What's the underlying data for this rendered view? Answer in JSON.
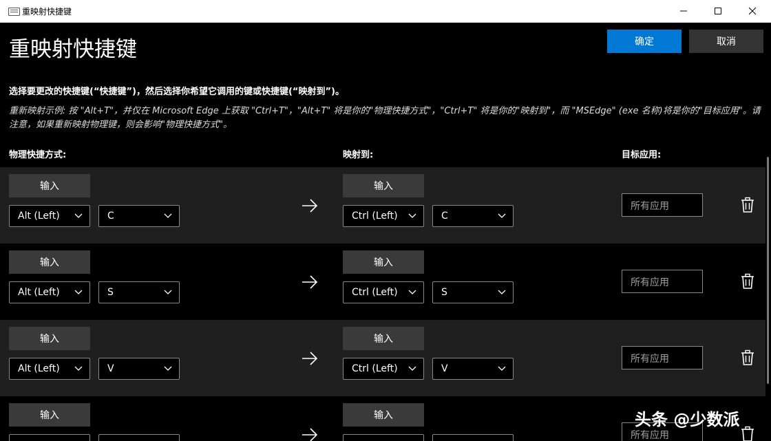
{
  "window": {
    "title": "重映射快捷键"
  },
  "header": {
    "title": "重映射快捷键",
    "ok_label": "确定",
    "cancel_label": "取消"
  },
  "instructions": "选择要更改的快捷键(“快捷键”)，然后选择你希望它调用的键或快捷键(“映射到”)。",
  "example": "重新映射示例: 按 \"Alt+T\"，并仅在 Microsoft Edge 上获取 \"Ctrl+T\"，\"Alt+T\" 将是你的\"物理快捷方式\"，\"Ctrl+T\" 将是你的\"映射到\"，而 \"MSEdge\" (exe 名称)将是你的\"目标应用\"。请注意，如果重新映射物理键，则会影响\"物理快捷方式\"。",
  "columns": {
    "physical": "物理快捷方式:",
    "mapped": "映射到:",
    "target": "目标应用:"
  },
  "rows": [
    {
      "input_label": "输入",
      "phys_mod": "Alt (Left)",
      "phys_key": "C",
      "map_input_label": "输入",
      "map_mod": "Ctrl (Left)",
      "map_key": "C",
      "target_placeholder": "所有应用"
    },
    {
      "input_label": "输入",
      "phys_mod": "Alt (Left)",
      "phys_key": "S",
      "map_input_label": "输入",
      "map_mod": "Ctrl (Left)",
      "map_key": "S",
      "target_placeholder": "所有应用"
    },
    {
      "input_label": "输入",
      "phys_mod": "Alt (Left)",
      "phys_key": "V",
      "map_input_label": "输入",
      "map_mod": "Ctrl (Left)",
      "map_key": "V",
      "target_placeholder": "所有应用"
    },
    {
      "input_label": "输入",
      "phys_mod": "",
      "phys_key": "",
      "map_input_label": "输入",
      "map_mod": "",
      "map_key": "",
      "target_placeholder": "所有应用"
    }
  ],
  "watermark": "头条 @少数派",
  "colors": {
    "accent": "#0078d4",
    "row_alt": "#1f1f1f",
    "background": "#000000"
  },
  "icons": [
    "keyboard-icon",
    "minimize-icon",
    "maximize-icon",
    "close-icon",
    "chevron-down-icon",
    "arrow-right-icon",
    "trash-icon"
  ]
}
